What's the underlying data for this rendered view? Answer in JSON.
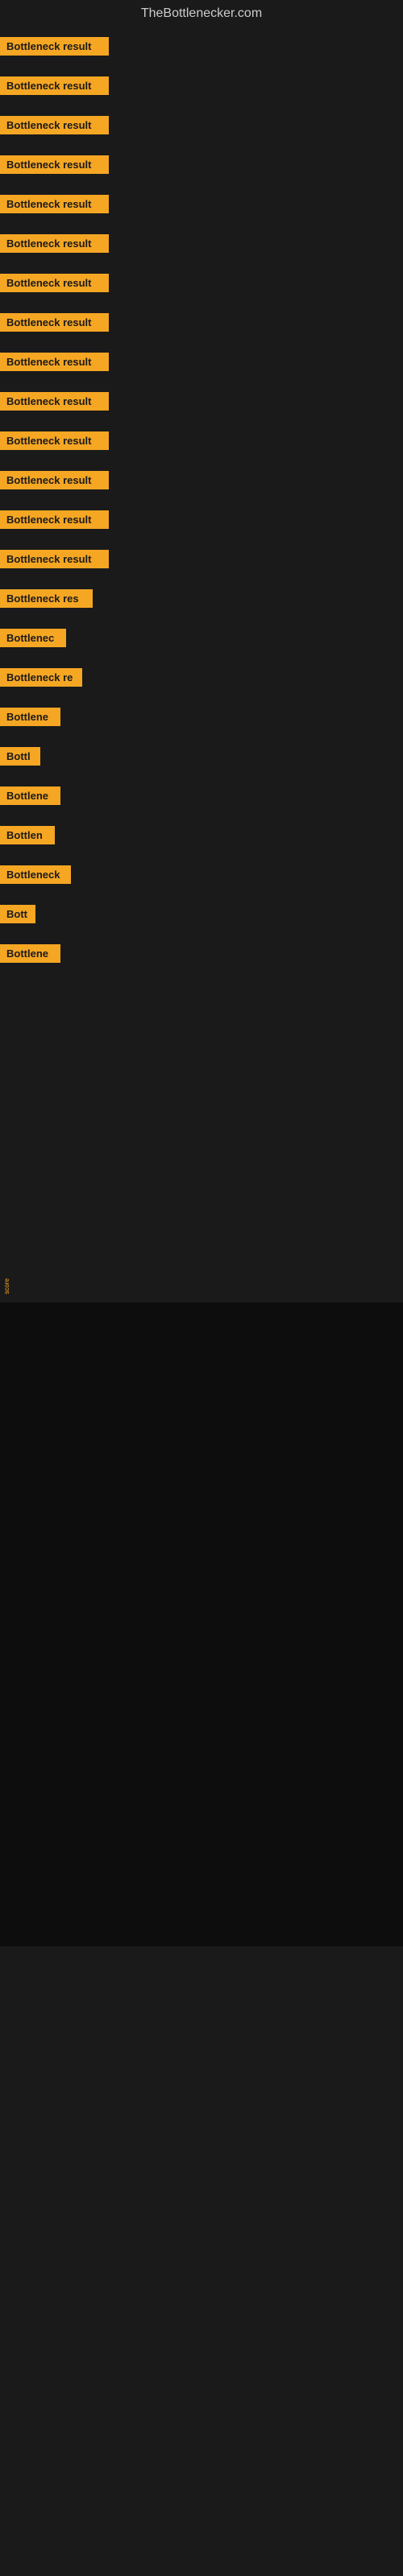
{
  "site": {
    "title": "TheBottlenecker.com"
  },
  "bars": [
    {
      "label": "Bottleneck result",
      "width": 135
    },
    {
      "label": "Bottleneck result",
      "width": 135
    },
    {
      "label": "Bottleneck result",
      "width": 135
    },
    {
      "label": "Bottleneck result",
      "width": 135
    },
    {
      "label": "Bottleneck result",
      "width": 135
    },
    {
      "label": "Bottleneck result",
      "width": 135
    },
    {
      "label": "Bottleneck result",
      "width": 135
    },
    {
      "label": "Bottleneck result",
      "width": 135
    },
    {
      "label": "Bottleneck result",
      "width": 135
    },
    {
      "label": "Bottleneck result",
      "width": 135
    },
    {
      "label": "Bottleneck result",
      "width": 135
    },
    {
      "label": "Bottleneck result",
      "width": 135
    },
    {
      "label": "Bottleneck result",
      "width": 135
    },
    {
      "label": "Bottleneck result",
      "width": 135
    },
    {
      "label": "Bottleneck res",
      "width": 115
    },
    {
      "label": "Bottlenec",
      "width": 82
    },
    {
      "label": "Bottleneck re",
      "width": 102
    },
    {
      "label": "Bottlene",
      "width": 75
    },
    {
      "label": "Bottl",
      "width": 50
    },
    {
      "label": "Bottlene",
      "width": 75
    },
    {
      "label": "Bottlen",
      "width": 68
    },
    {
      "label": "Bottleneck",
      "width": 88
    },
    {
      "label": "Bott",
      "width": 44
    },
    {
      "label": "Bottlene",
      "width": 75
    }
  ],
  "tiny_label": "score"
}
